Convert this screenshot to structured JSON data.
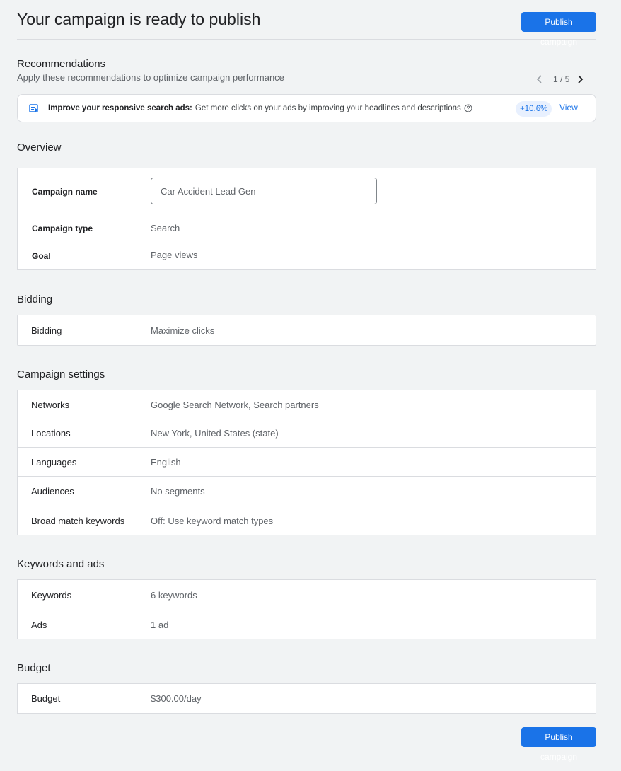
{
  "header": {
    "title": "Your campaign is ready to publish",
    "publish_label": "Publish campaign"
  },
  "recommendations": {
    "title": "Recommendations",
    "subtitle": "Apply these recommendations to optimize campaign performance",
    "pager": "1 / 5",
    "card": {
      "icon": "responsive-ad-icon",
      "bold": "Improve your responsive search ads:",
      "text": "Get more clicks on your ads by improving your headlines and descriptions",
      "badge": "+10.6%",
      "view_label": "View"
    }
  },
  "overview": {
    "title": "Overview",
    "campaign_name_label": "Campaign name",
    "campaign_name_value": "Car Accident Lead Gen",
    "campaign_type_label": "Campaign type",
    "campaign_type_value": "Search",
    "goal_label": "Goal",
    "goal_value": "Page views"
  },
  "bidding": {
    "title": "Bidding",
    "rows": [
      {
        "label": "Bidding",
        "value": "Maximize clicks"
      }
    ]
  },
  "campaign_settings": {
    "title": "Campaign settings",
    "rows": [
      {
        "label": "Networks",
        "value": "Google Search Network, Search partners"
      },
      {
        "label": "Locations",
        "value": "New York, United States (state)"
      },
      {
        "label": "Languages",
        "value": "English"
      },
      {
        "label": "Audiences",
        "value": "No segments"
      },
      {
        "label": "Broad match keywords",
        "value": "Off: Use keyword match types"
      }
    ]
  },
  "keywords_ads": {
    "title": "Keywords and ads",
    "rows": [
      {
        "label": "Keywords",
        "value": "6 keywords"
      },
      {
        "label": "Ads",
        "value": "1 ad"
      }
    ]
  },
  "budget": {
    "title": "Budget",
    "rows": [
      {
        "label": "Budget",
        "value": "$300.00/day"
      }
    ]
  },
  "footer": {
    "publish_label": "Publish campaign"
  },
  "colors": {
    "accent": "#1a73e8",
    "background": "#f1f3f4"
  }
}
